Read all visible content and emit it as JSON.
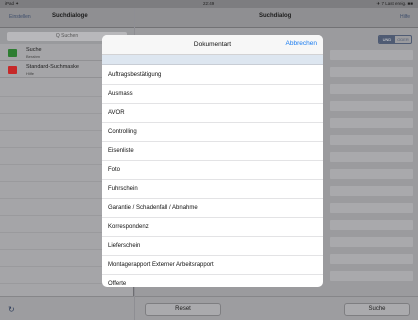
{
  "status_bar": {
    "carrier": "iPad ✦",
    "time": "22:49",
    "battery": "✈ 7 Last ereig. ■■"
  },
  "left_pane": {
    "back_label": "Einstellen",
    "title": "Suchdialoge",
    "search_placeholder": "Q Suchen",
    "items": [
      {
        "title": "Suche",
        "subtitle": "Berabm",
        "icon_color": "#2e7d32"
      },
      {
        "title": "Standard-Suchmaske",
        "subtitle": "Hilfe",
        "icon_color": "#c62828"
      }
    ],
    "refresh_icon": "↻"
  },
  "right_pane": {
    "title": "Suchdialog",
    "help_label": "Hilfe",
    "segment": [
      "UND",
      "ODER"
    ],
    "reset_label": "Reset",
    "search_label": "Suche"
  },
  "modal": {
    "title": "Dokumentart",
    "cancel_label": "Abbrechen",
    "options": [
      "Auftragsbestätigung",
      "Ausmass",
      "AVOR",
      "Controlling",
      "Eisenliste",
      "Foto",
      "Fuhrschein",
      "Garantie / Schadenfall / Abnahme",
      "Korrespondenz",
      "Lieferschein",
      "Montagerapport Externer Arbeitsrapport",
      "Offerte"
    ]
  }
}
